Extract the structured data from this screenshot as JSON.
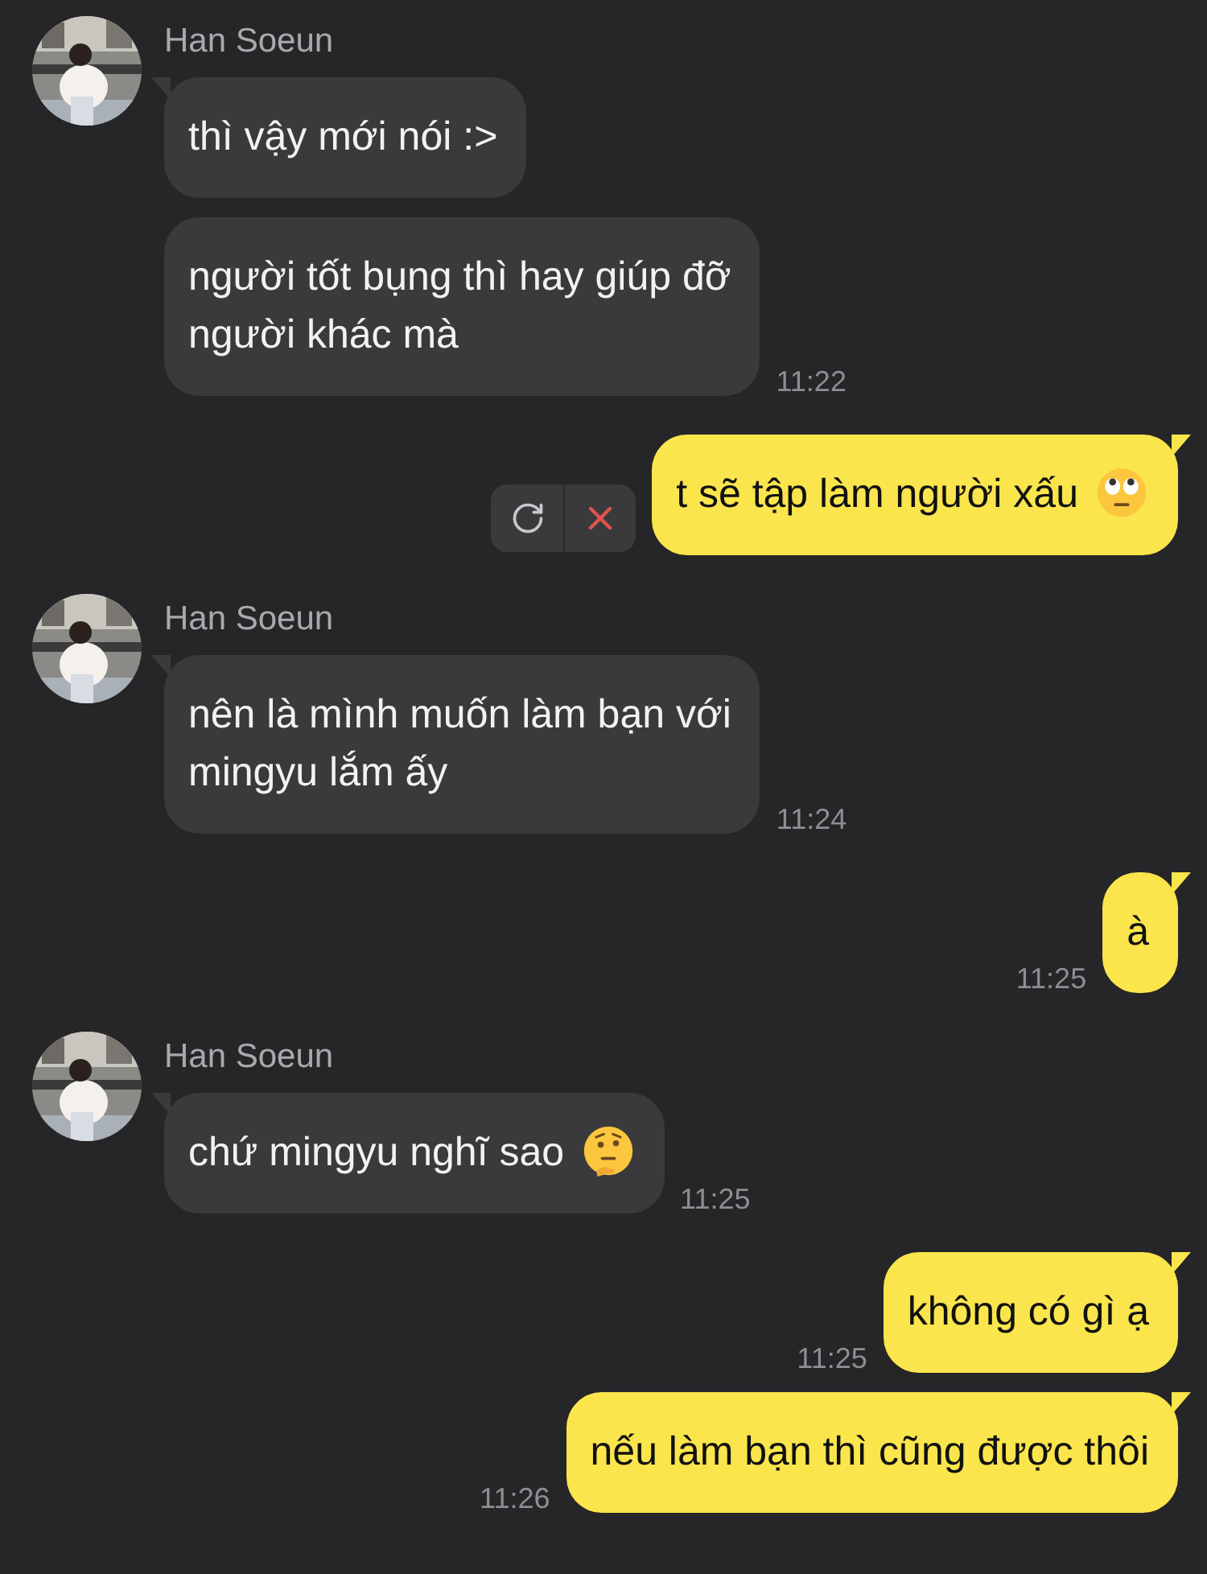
{
  "groups": [
    {
      "kind": "incoming",
      "sender": "Han Soeun",
      "messages": [
        {
          "text": "thì vậy mới nói :>"
        },
        {
          "text": "người tốt bụng thì hay giúp đỡ\nngười khác mà",
          "time": "11:22"
        }
      ]
    },
    {
      "kind": "outgoing",
      "messages": [
        {
          "text": "t sẽ tập làm người xấu",
          "kind": "eyeroll",
          "failed": true
        }
      ]
    },
    {
      "kind": "incoming",
      "sender": "Han Soeun",
      "messages": [
        {
          "text": "nên là mình muốn làm bạn với\nmingyu lắm ấy",
          "time": "11:24"
        }
      ]
    },
    {
      "kind": "outgoing",
      "messages": [
        {
          "text": "à",
          "time": "11:25",
          "failed": false
        }
      ]
    },
    {
      "kind": "incoming",
      "sender": "Han Soeun",
      "messages": [
        {
          "text": "chứ mingyu nghĩ sao",
          "kind": "thinking",
          "time": "11:25"
        }
      ]
    },
    {
      "kind": "outgoing",
      "messages": [
        {
          "text": "không có gì ạ",
          "time": "11:25",
          "failed": false
        },
        {
          "text": "nếu làm bạn thì cũng được thôi",
          "time": "11:26",
          "failed": false
        }
      ]
    }
  ]
}
